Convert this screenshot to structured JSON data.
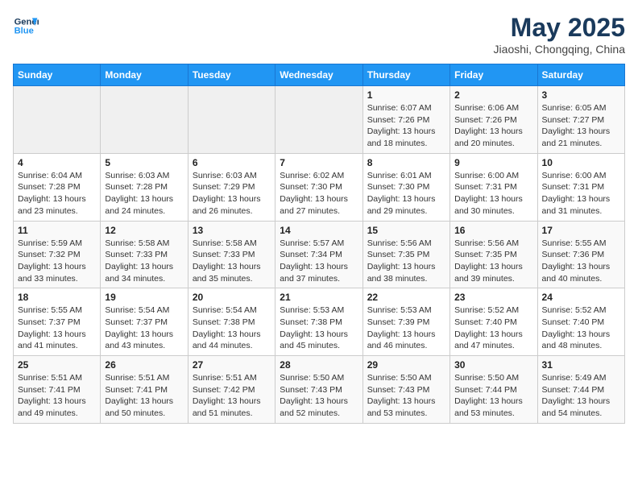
{
  "header": {
    "logo_line1": "General",
    "logo_line2": "Blue",
    "title": "May 2025",
    "subtitle": "Jiaoshi, Chongqing, China"
  },
  "days_of_week": [
    "Sunday",
    "Monday",
    "Tuesday",
    "Wednesday",
    "Thursday",
    "Friday",
    "Saturday"
  ],
  "weeks": [
    [
      {
        "day": "",
        "info": ""
      },
      {
        "day": "",
        "info": ""
      },
      {
        "day": "",
        "info": ""
      },
      {
        "day": "",
        "info": ""
      },
      {
        "day": "1",
        "info": "Sunrise: 6:07 AM\nSunset: 7:26 PM\nDaylight: 13 hours\nand 18 minutes."
      },
      {
        "day": "2",
        "info": "Sunrise: 6:06 AM\nSunset: 7:26 PM\nDaylight: 13 hours\nand 20 minutes."
      },
      {
        "day": "3",
        "info": "Sunrise: 6:05 AM\nSunset: 7:27 PM\nDaylight: 13 hours\nand 21 minutes."
      }
    ],
    [
      {
        "day": "4",
        "info": "Sunrise: 6:04 AM\nSunset: 7:28 PM\nDaylight: 13 hours\nand 23 minutes."
      },
      {
        "day": "5",
        "info": "Sunrise: 6:03 AM\nSunset: 7:28 PM\nDaylight: 13 hours\nand 24 minutes."
      },
      {
        "day": "6",
        "info": "Sunrise: 6:03 AM\nSunset: 7:29 PM\nDaylight: 13 hours\nand 26 minutes."
      },
      {
        "day": "7",
        "info": "Sunrise: 6:02 AM\nSunset: 7:30 PM\nDaylight: 13 hours\nand 27 minutes."
      },
      {
        "day": "8",
        "info": "Sunrise: 6:01 AM\nSunset: 7:30 PM\nDaylight: 13 hours\nand 29 minutes."
      },
      {
        "day": "9",
        "info": "Sunrise: 6:00 AM\nSunset: 7:31 PM\nDaylight: 13 hours\nand 30 minutes."
      },
      {
        "day": "10",
        "info": "Sunrise: 6:00 AM\nSunset: 7:31 PM\nDaylight: 13 hours\nand 31 minutes."
      }
    ],
    [
      {
        "day": "11",
        "info": "Sunrise: 5:59 AM\nSunset: 7:32 PM\nDaylight: 13 hours\nand 33 minutes."
      },
      {
        "day": "12",
        "info": "Sunrise: 5:58 AM\nSunset: 7:33 PM\nDaylight: 13 hours\nand 34 minutes."
      },
      {
        "day": "13",
        "info": "Sunrise: 5:58 AM\nSunset: 7:33 PM\nDaylight: 13 hours\nand 35 minutes."
      },
      {
        "day": "14",
        "info": "Sunrise: 5:57 AM\nSunset: 7:34 PM\nDaylight: 13 hours\nand 37 minutes."
      },
      {
        "day": "15",
        "info": "Sunrise: 5:56 AM\nSunset: 7:35 PM\nDaylight: 13 hours\nand 38 minutes."
      },
      {
        "day": "16",
        "info": "Sunrise: 5:56 AM\nSunset: 7:35 PM\nDaylight: 13 hours\nand 39 minutes."
      },
      {
        "day": "17",
        "info": "Sunrise: 5:55 AM\nSunset: 7:36 PM\nDaylight: 13 hours\nand 40 minutes."
      }
    ],
    [
      {
        "day": "18",
        "info": "Sunrise: 5:55 AM\nSunset: 7:37 PM\nDaylight: 13 hours\nand 41 minutes."
      },
      {
        "day": "19",
        "info": "Sunrise: 5:54 AM\nSunset: 7:37 PM\nDaylight: 13 hours\nand 43 minutes."
      },
      {
        "day": "20",
        "info": "Sunrise: 5:54 AM\nSunset: 7:38 PM\nDaylight: 13 hours\nand 44 minutes."
      },
      {
        "day": "21",
        "info": "Sunrise: 5:53 AM\nSunset: 7:38 PM\nDaylight: 13 hours\nand 45 minutes."
      },
      {
        "day": "22",
        "info": "Sunrise: 5:53 AM\nSunset: 7:39 PM\nDaylight: 13 hours\nand 46 minutes."
      },
      {
        "day": "23",
        "info": "Sunrise: 5:52 AM\nSunset: 7:40 PM\nDaylight: 13 hours\nand 47 minutes."
      },
      {
        "day": "24",
        "info": "Sunrise: 5:52 AM\nSunset: 7:40 PM\nDaylight: 13 hours\nand 48 minutes."
      }
    ],
    [
      {
        "day": "25",
        "info": "Sunrise: 5:51 AM\nSunset: 7:41 PM\nDaylight: 13 hours\nand 49 minutes."
      },
      {
        "day": "26",
        "info": "Sunrise: 5:51 AM\nSunset: 7:41 PM\nDaylight: 13 hours\nand 50 minutes."
      },
      {
        "day": "27",
        "info": "Sunrise: 5:51 AM\nSunset: 7:42 PM\nDaylight: 13 hours\nand 51 minutes."
      },
      {
        "day": "28",
        "info": "Sunrise: 5:50 AM\nSunset: 7:43 PM\nDaylight: 13 hours\nand 52 minutes."
      },
      {
        "day": "29",
        "info": "Sunrise: 5:50 AM\nSunset: 7:43 PM\nDaylight: 13 hours\nand 53 minutes."
      },
      {
        "day": "30",
        "info": "Sunrise: 5:50 AM\nSunset: 7:44 PM\nDaylight: 13 hours\nand 53 minutes."
      },
      {
        "day": "31",
        "info": "Sunrise: 5:49 AM\nSunset: 7:44 PM\nDaylight: 13 hours\nand 54 minutes."
      }
    ]
  ]
}
